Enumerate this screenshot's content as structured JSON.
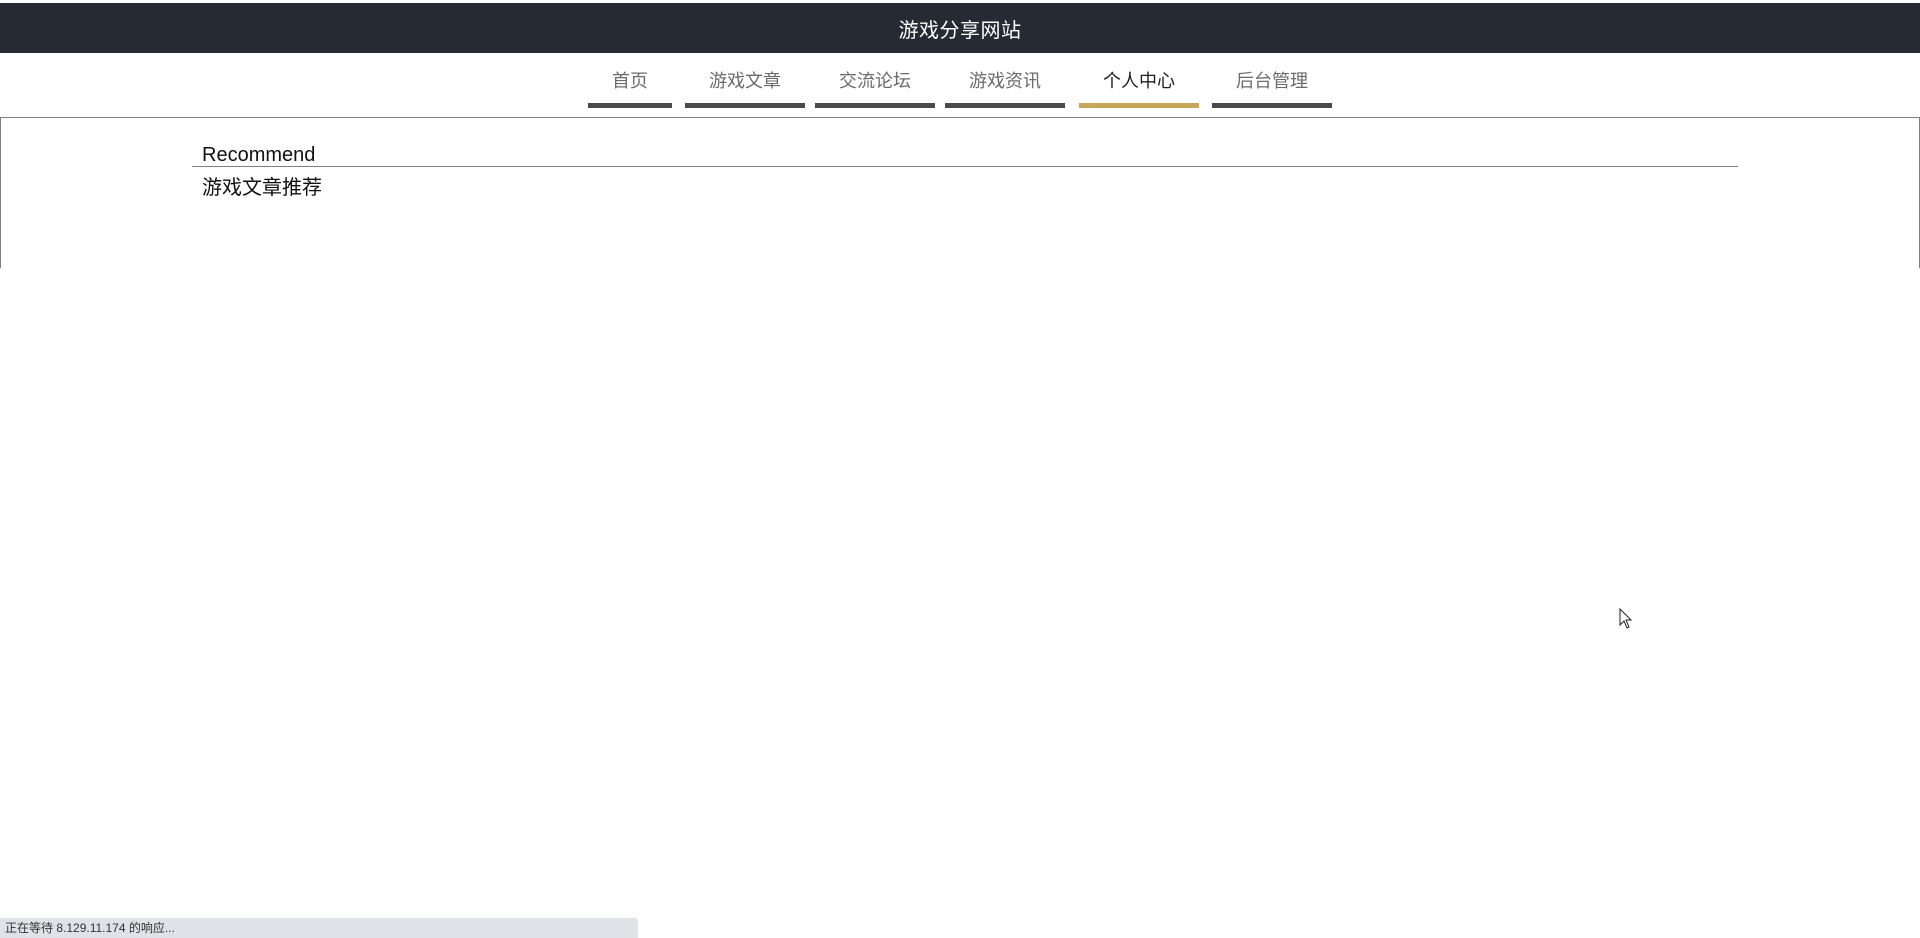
{
  "header": {
    "title": "游戏分享网站"
  },
  "nav": {
    "items": [
      {
        "label": "首页",
        "active": false
      },
      {
        "label": "游戏文章",
        "active": false
      },
      {
        "label": "交流论坛",
        "active": false
      },
      {
        "label": "游戏资讯",
        "active": false
      },
      {
        "label": "个人中心",
        "active": true
      },
      {
        "label": "后台管理",
        "active": false
      }
    ],
    "active_color": "#c8a659",
    "inactive_bar_color": "#4a4a4a"
  },
  "content": {
    "heading": "Recommend",
    "subheading": "游戏文章推荐"
  },
  "status_bar": {
    "text": "正在等待 8.129.11.174 的响应..."
  },
  "colors": {
    "header_bg": "#262a33"
  }
}
